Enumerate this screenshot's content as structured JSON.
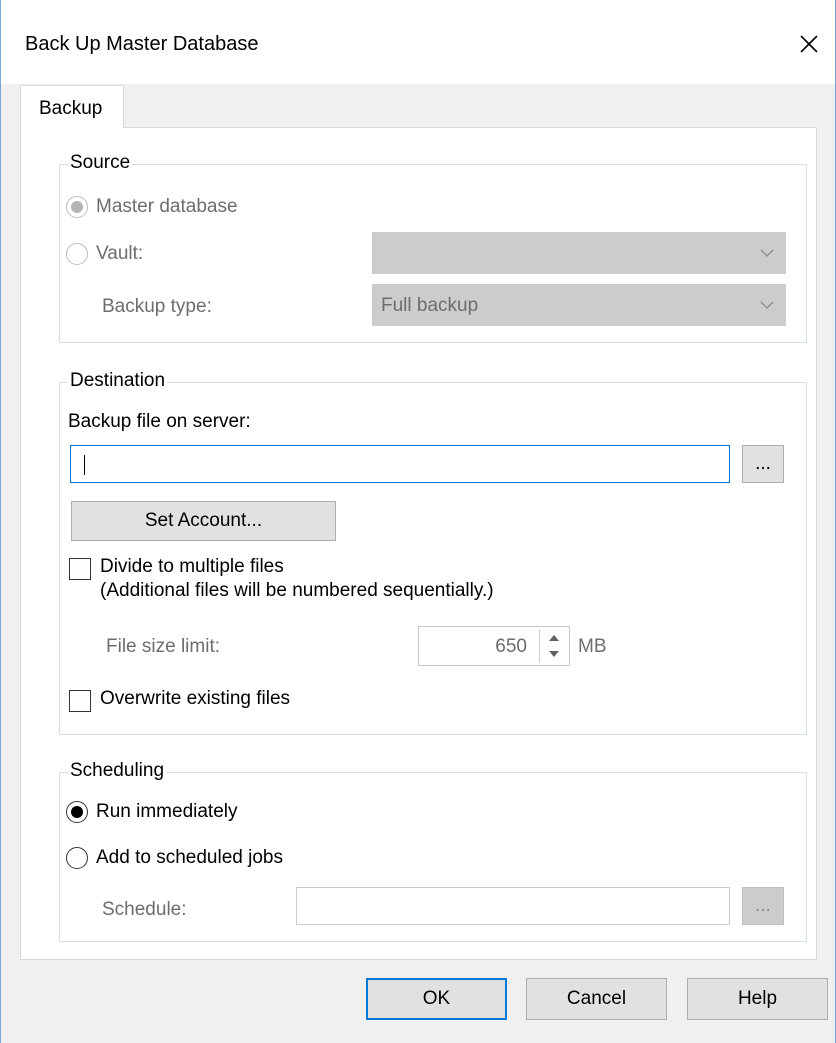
{
  "window": {
    "title": "Back Up Master Database",
    "close_glyph": "✕"
  },
  "tabs": [
    {
      "label": "Backup"
    }
  ],
  "source": {
    "legend": "Source",
    "master_radio": "Master database",
    "vault_radio": "Vault:",
    "vault_value": "",
    "backup_type_label": "Backup type:",
    "backup_type_value": "Full backup"
  },
  "destination": {
    "legend": "Destination",
    "backup_file_label": "Backup file on server:",
    "backup_file_value": "",
    "browse_label": "...",
    "set_account_label": "Set Account...",
    "divide_label": "Divide to multiple files",
    "divide_note": "(Additional files will be numbered sequentially.)",
    "file_size_label": "File size limit:",
    "file_size_value": "650",
    "file_size_unit": "MB",
    "overwrite_label": "Overwrite existing files"
  },
  "scheduling": {
    "legend": "Scheduling",
    "run_now_label": "Run immediately",
    "add_jobs_label": "Add to scheduled jobs",
    "schedule_label": "Schedule:",
    "schedule_value": "",
    "schedule_browse_label": "..."
  },
  "footer": {
    "ok_label": "OK",
    "cancel_label": "Cancel",
    "help_label": "Help"
  },
  "icons": {
    "close": "close-icon",
    "chevron": "chevron-down-icon",
    "spin_up": "spin-up-icon",
    "spin_down": "spin-down-icon"
  }
}
